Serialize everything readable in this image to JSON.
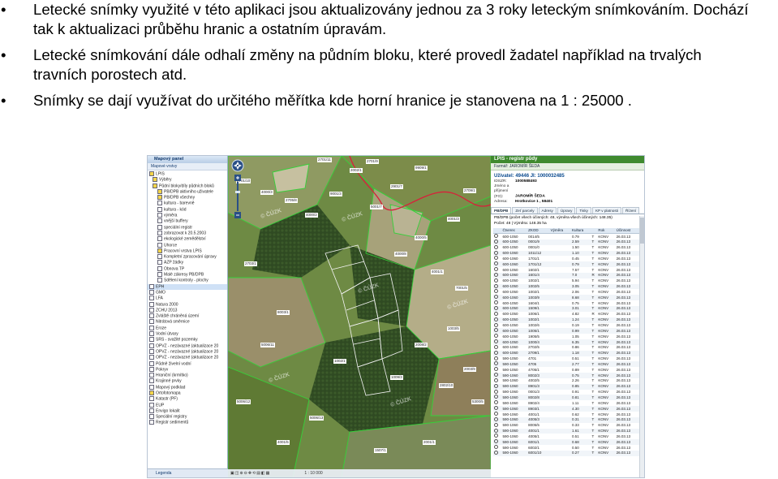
{
  "bullets": [
    {
      "symbol": "•",
      "lines": [
        "Letecké snímky využité v této aplikaci jsou aktualizovány jednou za 3 roky leteckým snímkováním. Dochází",
        "tak k aktualizaci průběhu hranic a ostatním úpravám."
      ]
    },
    {
      "symbol": "•",
      "lines": [
        "Letecké snímkování dále odhalí změny na půdním bloku, které provedl žadatel například na trvalých",
        "travních porostech atd."
      ]
    },
    {
      "symbol": "•",
      "lines": [
        "Snímky se dají využívat do určitého měřítka kde horní hranice je stanovena na  1 : 25000 ."
      ]
    }
  ],
  "screenshot": {
    "left_panel": {
      "title": "Mapový panel",
      "toolbar": "Mapové vrstvy",
      "footer": "Legenda",
      "tree": [
        {
          "label": "LPIS",
          "checked": true
        },
        {
          "label": "Výběry",
          "checked": true
        },
        {
          "label": "Půdní bloky/díly půdních bloků",
          "checked": true
        },
        {
          "label": "PB/DPB aktivního uživatele",
          "checked": true
        },
        {
          "label": "PB/DPB všechny",
          "checked": true
        },
        {
          "label": "kultura - barevně",
          "checked": false
        },
        {
          "label": "kultura - kód",
          "checked": false
        },
        {
          "label": "výměra",
          "checked": false
        },
        {
          "label": "vnější buffery",
          "checked": false
        },
        {
          "label": "speciální registr",
          "checked": false
        },
        {
          "label": "zobrazovat k 20.5.2003",
          "checked": false
        },
        {
          "label": "ekologické zemědělství",
          "checked": false
        },
        {
          "label": "Úhorce",
          "checked": false
        },
        {
          "label": "Pracovní vrstva LPIS",
          "checked": true
        },
        {
          "label": "Kompletní zpracování úpravy",
          "checked": false
        },
        {
          "label": "AZP žádky",
          "checked": false
        },
        {
          "label": "Obnova TP",
          "checked": false
        },
        {
          "label": "Malé zákresy PB/DPB",
          "checked": false
        },
        {
          "label": "Sdělení kontroly - plochy",
          "checked": false
        },
        {
          "label": "EPH",
          "checked": false,
          "selected": true
        },
        {
          "label": "GMO",
          "checked": false
        },
        {
          "label": "LFA",
          "checked": false
        },
        {
          "label": "Natura 2000",
          "checked": false
        },
        {
          "label": "ZCHÚ 2013",
          "checked": false
        },
        {
          "label": "Zvláště chráněná území",
          "checked": false
        },
        {
          "label": "Nitrátová směrnice",
          "checked": false
        },
        {
          "label": "Eroze",
          "checked": false
        },
        {
          "label": "Vodní útvary",
          "checked": false
        },
        {
          "label": "SRS - svažité pozemky",
          "checked": false
        },
        {
          "label": "OPVZ - nezávazné (aktualizace 20",
          "checked": false
        },
        {
          "label": "OPVZ - nezávazné (aktualizace 20",
          "checked": false
        },
        {
          "label": "OPVZ - nezávazné (aktualizace 20",
          "checked": false
        },
        {
          "label": "Půdně živelní vodní",
          "checked": false
        },
        {
          "label": "Pokryv",
          "checked": false
        },
        {
          "label": "Hraniční (krmítko)",
          "checked": false
        },
        {
          "label": "Krajinné prvky",
          "checked": false
        },
        {
          "label": "Mapový podklad",
          "checked": false
        },
        {
          "label": "Ortofotomapa",
          "checked": true
        },
        {
          "label": "Katastr (PF)",
          "checked": false
        },
        {
          "label": "EUP",
          "checked": false
        },
        {
          "label": "Envigo lokalit",
          "checked": false
        },
        {
          "label": "Speciální registry",
          "checked": false
        },
        {
          "label": "Registr sedimentů",
          "checked": false
        }
      ]
    },
    "map": {
      "watermark": "© ČÚZK",
      "scale_label": "1 : 10 000",
      "footer": "1:10 000",
      "parcel_labels": [
        "2701/11",
        "2701/9",
        "2701/10",
        "9909/1",
        "2705/8",
        "2901/7",
        "4000/2",
        "4000/3",
        "9001/3",
        "4000/5",
        "4000/8",
        "4001/1",
        "7001/5",
        "1002/1",
        "1003/5",
        "2709/1",
        "2703/1",
        "8003/1",
        "1009/3",
        "2802/10",
        "5006/12",
        "5006/13",
        "5300/5",
        "2008/2",
        "2002/1",
        "4001/3",
        "5001/7",
        "5006/11",
        "2003/9",
        "1507/1",
        "4001/5",
        "2001/1"
      ]
    },
    "right_panel": {
      "title": "LPIS - registr půdy",
      "subtitle": "Farmář: JAROMÍR ŠEDA",
      "user_title": "Uživatel: 49446 JI: 1000032485",
      "fields": [
        {
          "k": "IDSZR:",
          "v": "1000588493"
        },
        {
          "k": "Jméno a příjmení (FO):",
          "v": "JAROMÍR ŠEDA"
        },
        {
          "k": "Adresa:",
          "v": "Hrotkovice 1 , 58401"
        }
      ],
      "tabs": [
        "PB/DPB",
        "Zeť parcely",
        "Adresy",
        "Úpravy",
        "Tisky",
        "KP v platnosti",
        "Řízení",
        "Hospodářství",
        "Účetní",
        "Žádosti"
      ],
      "section": "PB/DPB (počet všech účinných: 48, výměra všech účinných: 148.35)",
      "count": "Počet: 48 | Výměra: 148.35 ha",
      "columns": [
        "",
        "Čtverec",
        "ZKOD",
        "Výměra",
        "Kultura",
        "",
        "Rok",
        "Účinnost"
      ],
      "rows": [
        [
          "600-1050",
          "0014/5",
          "0.79",
          "T",
          "KONV",
          "26.03.13"
        ],
        [
          "600-1050",
          "0001/9",
          "2.59",
          "T",
          "KONV",
          "26.03.13"
        ],
        [
          "600-1050",
          "0001/0",
          "1.50",
          "T",
          "KONV",
          "26.03.13"
        ],
        [
          "600-1060",
          "1011/12",
          "1.10",
          "T",
          "KONV",
          "26.03.13"
        ],
        [
          "600-1060",
          "1701/1",
          "0.45",
          "T",
          "KONV",
          "26.03.13"
        ],
        [
          "600-1060",
          "1701/12",
          "0.79",
          "T",
          "KONV",
          "26.03.13"
        ],
        [
          "600-1050",
          "1602/1",
          "7.57",
          "T",
          "KONV",
          "26.03.13"
        ],
        [
          "600-1060",
          "1601/4",
          "7.0",
          "R",
          "KONV",
          "26.03.13"
        ],
        [
          "600-1050",
          "1002/1",
          "5.94",
          "T",
          "KONV",
          "26.03.13"
        ],
        [
          "600-1050",
          "1002/5",
          "3.05",
          "T",
          "KONV",
          "26.03.13"
        ],
        [
          "600-1050",
          "1002/1",
          "2.06",
          "T",
          "KONV",
          "26.03.13"
        ],
        [
          "600-1060",
          "1003/9",
          "8.68",
          "T",
          "KONV",
          "26.03.13"
        ],
        [
          "600-1050",
          "1604/1",
          "0.75",
          "T",
          "KONV",
          "26.03.13"
        ],
        [
          "600-1050",
          "1509/1",
          "3.01",
          "T",
          "KONV",
          "26.03.13"
        ],
        [
          "600-1050",
          "1006/1",
          "4.82",
          "R",
          "KONV",
          "26.03.13"
        ],
        [
          "600-1050",
          "1002/1",
          "1.24",
          "T",
          "KONV",
          "26.03.13"
        ],
        [
          "600-1050",
          "1002/6",
          "0.19",
          "T",
          "KONV",
          "26.03.13"
        ],
        [
          "600-1050",
          "1005/1",
          "0.99",
          "T",
          "KONV",
          "26.03.13"
        ],
        [
          "600-1050",
          "1905/5",
          "1.05",
          "T",
          "KONV",
          "26.03.13"
        ],
        [
          "600-1050",
          "1000/4",
          "6.35",
          "T",
          "KONV",
          "26.03.13"
        ],
        [
          "600-1060",
          "2702/5",
          "0.86",
          "T",
          "KONV",
          "26.03.13"
        ],
        [
          "600-1060",
          "2709/1",
          "1.18",
          "T",
          "KONV",
          "26.03.13"
        ],
        [
          "590-1050",
          "4701",
          "0.51",
          "T",
          "KONV",
          "26.03.13"
        ],
        [
          "590-1050",
          "4705",
          "2.77",
          "T",
          "KONV",
          "26.03.13"
        ],
        [
          "590-1050",
          "4705/1",
          "0.89",
          "T",
          "KONV",
          "26.03.13"
        ],
        [
          "590-1060",
          "8002/3",
          "0.75",
          "T",
          "KONV",
          "26.03.13"
        ],
        [
          "590-1060",
          "4002/5",
          "2.26",
          "T",
          "KONV",
          "26.03.13"
        ],
        [
          "590-1060",
          "8901/3",
          "0.85",
          "T",
          "KONV",
          "26.03.13"
        ],
        [
          "590-1060",
          "0001/3",
          "0.91",
          "T",
          "KONV",
          "26.03.13"
        ],
        [
          "590-1060",
          "8002/8",
          "0.81",
          "T",
          "KONV",
          "26.03.13"
        ],
        [
          "590-1060",
          "8902/4",
          "1.11",
          "T",
          "KONV",
          "26.03.13"
        ],
        [
          "590-1060",
          "8903/1",
          "4.30",
          "T",
          "KONV",
          "26.03.13"
        ],
        [
          "590-1060",
          "4001/1",
          "0.62",
          "T",
          "KONV",
          "26.03.13"
        ],
        [
          "590-1060",
          "4005/3",
          "0.31",
          "T",
          "KONV",
          "26.03.13"
        ],
        [
          "590-1060",
          "8005/5",
          "0.33",
          "T",
          "KONV",
          "26.03.13"
        ],
        [
          "590-1060",
          "4001/1",
          "1.61",
          "T",
          "KONV",
          "26.03.13"
        ],
        [
          "590-1060",
          "4005/1",
          "0.51",
          "T",
          "KONV",
          "26.03.13"
        ],
        [
          "590-1060",
          "6001/1",
          "0.68",
          "T",
          "KONV",
          "26.03.13"
        ],
        [
          "590-1060",
          "6002/1",
          "0.50",
          "T",
          "KONV",
          "26.03.13"
        ],
        [
          "590-1060",
          "6001/10",
          "0.27",
          "T",
          "KONV",
          "26.03.13"
        ]
      ]
    }
  }
}
